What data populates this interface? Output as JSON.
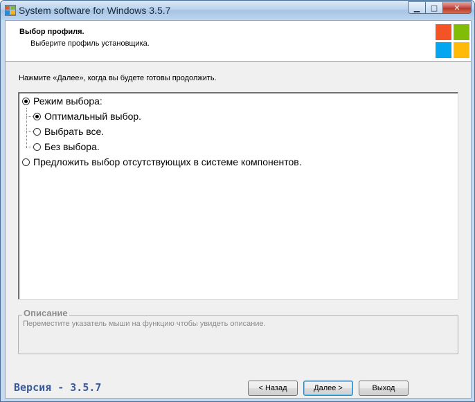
{
  "window": {
    "title": "System software for Windows 3.5.7",
    "minimize_glyph": "▁",
    "maximize_glyph": "□",
    "close_glyph": "✕"
  },
  "header": {
    "title": "Выбор профиля.",
    "subtitle": "Выберите профиль установщика."
  },
  "instruction": "Нажмите «Далее», когда вы будете готовы продолжить.",
  "profiles": {
    "items": [
      {
        "label": "Режим выбора:",
        "selected": true,
        "level": 0
      },
      {
        "label": "Оптимальный выбор.",
        "selected": true,
        "level": 1
      },
      {
        "label": "Выбрать все.",
        "selected": false,
        "level": 1
      },
      {
        "label": "Без выбора.",
        "selected": false,
        "level": 1
      },
      {
        "label": "Предложить выбор отсутствующих в системе компонентов.",
        "selected": false,
        "level": 0
      }
    ]
  },
  "description": {
    "legend": "Описание",
    "text": "Переместите указатель мыши на функцию чтобы увидеть описание."
  },
  "footer": {
    "version": "Версия - 3.5.7",
    "back_label": "< Назад",
    "next_label": "Далее >",
    "exit_label": "Выход"
  },
  "colors": {
    "logo_red": "#f35325",
    "logo_green": "#81bc06",
    "logo_blue": "#05a6f0",
    "logo_yellow": "#ffba08",
    "version_text": "#3a5a9a"
  },
  "icons": {
    "title": "windows-flag-icon",
    "logo": "windows-logo-icon"
  }
}
